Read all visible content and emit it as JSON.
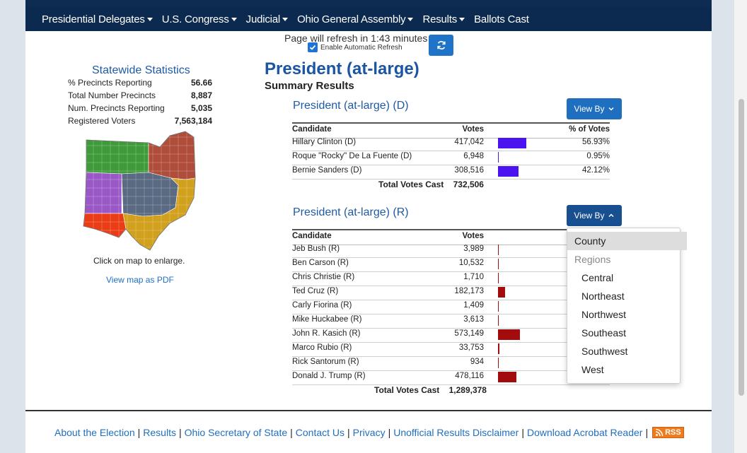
{
  "nav": {
    "items": [
      {
        "label": "Presidential Delegates",
        "caret": true
      },
      {
        "label": "U.S. Congress",
        "caret": true
      },
      {
        "label": "Judicial",
        "caret": true
      },
      {
        "label": "Ohio General Assembly",
        "caret": true
      },
      {
        "label": "Results",
        "caret": true
      },
      {
        "label": "Ballots Cast",
        "caret": false
      }
    ]
  },
  "refresh": {
    "text": "Page will refresh in 1:43 minutes",
    "auto_label": "Enable Automatic Refresh",
    "auto_checked": true,
    "button_icon": "refresh-icon"
  },
  "stats": {
    "title": "Statewide Statistics",
    "rows": [
      {
        "label": "% Precincts Reporting",
        "value": "56.66"
      },
      {
        "label": "Total Number Precincts",
        "value": "8,887"
      },
      {
        "label": "Num. Precincts Reporting",
        "value": "5,035"
      },
      {
        "label": "Registered Voters",
        "value": "7,563,184"
      }
    ],
    "map_note": "Click on map to enlarge.",
    "map_pdf": "View map as PDF",
    "map_region_colors": {
      "northwest": "#3f9a3a",
      "northeast": "#b04d3a",
      "west": "#9a58c7",
      "central": "#5a6a82",
      "southwest": "#ea3d16",
      "southeast": "#d1a01c"
    }
  },
  "main": {
    "title": "President (at-large)",
    "subtitle": "Summary Results",
    "dem": {
      "title": "President (at-large) (D)",
      "view_by": "View By",
      "headers": {
        "candidate": "Candidate",
        "votes": "Votes",
        "pct": "% of Votes"
      },
      "bar_color": "#4a13f0",
      "rows": [
        {
          "name": "Hillary Clinton (D)",
          "votes": "417,042",
          "pct": "56.93%",
          "share": 0.5693
        },
        {
          "name": "Roque \"Rocky\" De La Fuente (D)",
          "votes": "6,948",
          "pct": "0.95%",
          "share": 0.0095
        },
        {
          "name": "Bernie Sanders (D)",
          "votes": "308,516",
          "pct": "42.12%",
          "share": 0.4212
        }
      ],
      "total_label": "Total Votes Cast",
      "total": "732,506"
    },
    "rep": {
      "title": "President (at-large) (R)",
      "view_by": "View By",
      "headers": {
        "candidate": "Candidate",
        "votes": "Votes"
      },
      "bar_color": "#a30c0c",
      "rows": [
        {
          "name": "Jeb Bush (R)",
          "votes": "3,989",
          "share": 0.0031
        },
        {
          "name": "Ben Carson (R)",
          "votes": "10,532",
          "share": 0.0082
        },
        {
          "name": "Chris Christie (R)",
          "votes": "1,710",
          "share": 0.0013
        },
        {
          "name": "Ted Cruz (R)",
          "votes": "182,173",
          "share": 0.1413
        },
        {
          "name": "Carly Fiorina (R)",
          "votes": "1,409",
          "share": 0.0011
        },
        {
          "name": "Mike Huckabee (R)",
          "votes": "3,613",
          "share": 0.0028
        },
        {
          "name": "John R. Kasich (R)",
          "votes": "573,149",
          "share": 0.4445
        },
        {
          "name": "Marco Rubio (R)",
          "votes": "33,753",
          "share": 0.0262
        },
        {
          "name": "Rick Santorum (R)",
          "votes": "934",
          "share": 0.0007
        },
        {
          "name": "Donald J. Trump (R)",
          "votes": "478,116",
          "share": 0.3708
        }
      ],
      "total_label": "Total Votes Cast",
      "total": "1,289,378"
    }
  },
  "dropdown": {
    "items": [
      {
        "label": "County",
        "type": "option",
        "selected": true
      },
      {
        "label": "Regions",
        "type": "header"
      },
      {
        "label": "Central",
        "type": "sub"
      },
      {
        "label": "Northeast",
        "type": "sub"
      },
      {
        "label": "Northwest",
        "type": "sub"
      },
      {
        "label": "Southeast",
        "type": "sub"
      },
      {
        "label": "Southwest",
        "type": "sub"
      },
      {
        "label": "West",
        "type": "sub"
      }
    ]
  },
  "footer": {
    "links": [
      "About the Election",
      "Results",
      "Ohio Secretary of State",
      "Contact Us",
      "Privacy",
      "Unofficial Results Disclaimer",
      "Download Acrobat Reader"
    ],
    "rss": "RSS"
  }
}
